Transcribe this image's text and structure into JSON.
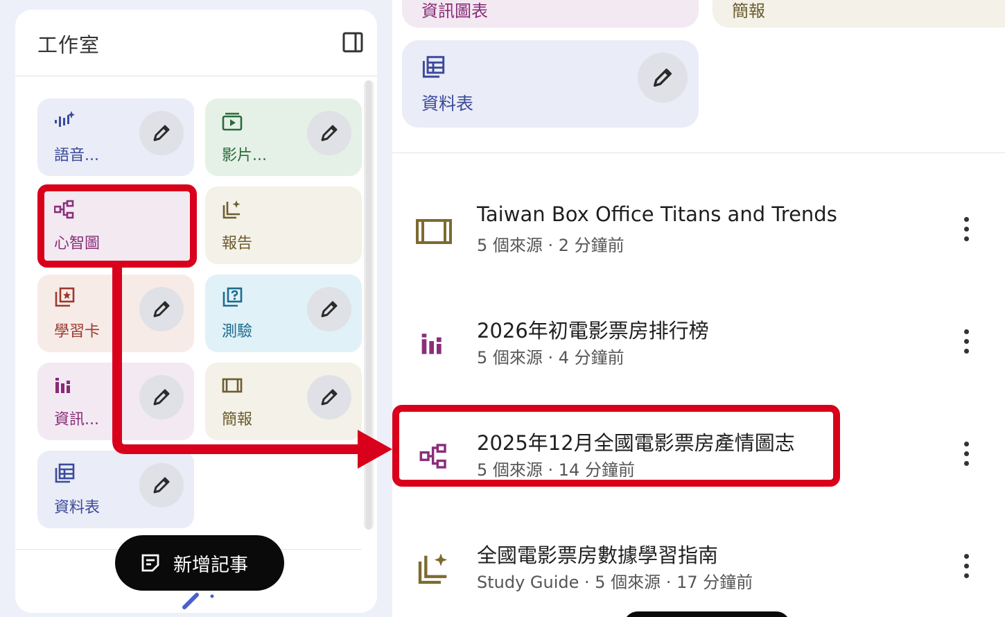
{
  "studio": {
    "title": "工作室",
    "tiles": [
      {
        "label": "語音...",
        "icon": "audio-sparkle-icon"
      },
      {
        "label": "影片...",
        "icon": "video-icon"
      },
      {
        "label": "心智圖",
        "icon": "mind-map-icon"
      },
      {
        "label": "報告",
        "icon": "report-sparkle-icon"
      },
      {
        "label": "學習卡",
        "icon": "flashcard-icon"
      },
      {
        "label": "測驗",
        "icon": "quiz-icon"
      },
      {
        "label": "資訊...",
        "icon": "infographic-icon"
      },
      {
        "label": "簡報",
        "icon": "slides-icon"
      },
      {
        "label": "資料表",
        "icon": "table-icon"
      }
    ],
    "add_note_label": "新增記事"
  },
  "right": {
    "top_tiles": [
      {
        "label": "資訊圖表"
      },
      {
        "label": "簡報"
      },
      {
        "label": "資料表"
      }
    ],
    "notes": [
      {
        "title": "Taiwan Box Office Titans and Trends",
        "meta": "5 個來源 · 2 分鐘前",
        "icon": "slides-icon"
      },
      {
        "title": "2026年初電影票房排行榜",
        "meta": "5 個來源 · 4 分鐘前",
        "icon": "infographic-icon"
      },
      {
        "title": "2025年12月全國電影票房產情圖志",
        "meta": "5 個來源 · 14 分鐘前",
        "icon": "mind-map-icon"
      },
      {
        "title": "全國電影票房數據學習指南",
        "meta": "Study Guide · 5 個來源 · 17 分鐘前",
        "icon": "report-sparkle-icon"
      }
    ]
  },
  "colors": {
    "highlight": "#d9001b",
    "mind_map": "#8a2e7a",
    "report": "#6c5d2e",
    "table": "#3b4a9a"
  }
}
